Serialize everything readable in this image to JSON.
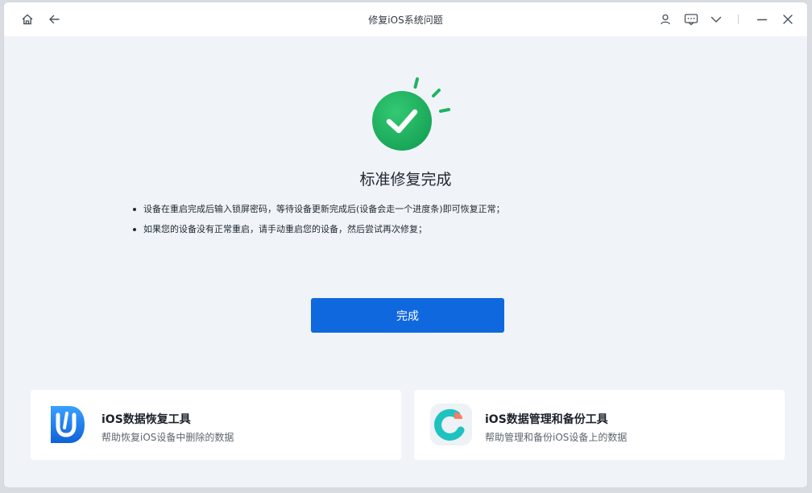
{
  "window": {
    "title": "修复iOS系统问题"
  },
  "titlebar": {
    "icons": [
      "home-icon",
      "back-arrow-icon",
      "user-icon",
      "feedback-icon",
      "chevron-down-icon",
      "minimize-icon",
      "close-icon"
    ]
  },
  "result": {
    "heading": "标准修复完成",
    "notes": [
      "设备在重启完成后输入锁屏密码，等待设备更新完成后(设备会走一个进度条)即可恢复正常；",
      "如果您的设备没有正常重启，请手动重启您的设备，然后尝试再次修复；"
    ],
    "done_label": "完成"
  },
  "cards": [
    {
      "title": "iOS数据恢复工具",
      "desc": "帮助恢复iOS设备中删除的数据",
      "icon": "data-recovery-icon"
    },
    {
      "title": "iOS数据管理和备份工具",
      "desc": "帮助管理和备份iOS设备上的数据",
      "icon": "data-manager-icon"
    }
  ],
  "colors": {
    "accent": "#1068df",
    "success": "#1fb460",
    "background": "#f0f4f8"
  }
}
